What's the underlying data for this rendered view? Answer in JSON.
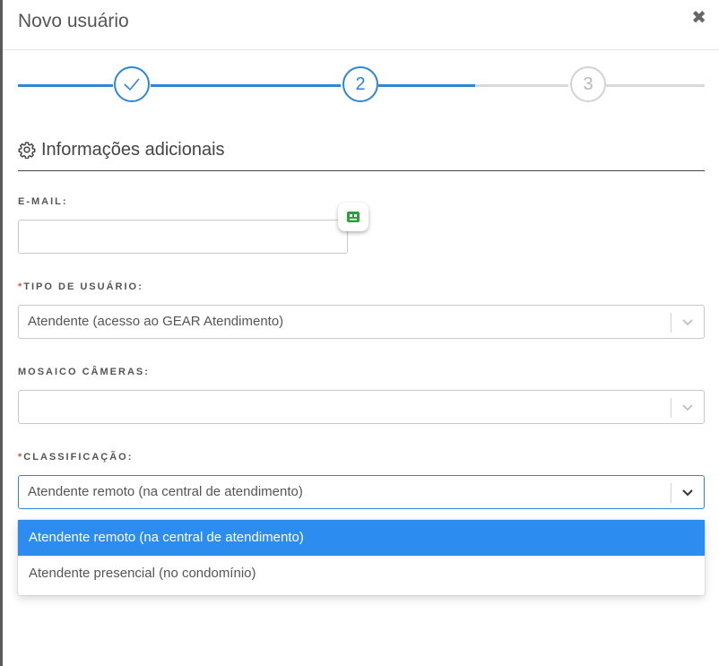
{
  "modal": {
    "title": "Novo usuário",
    "close_symbol": "✖"
  },
  "stepper": {
    "steps": [
      {
        "label": "",
        "state": "done",
        "icon": "check-icon"
      },
      {
        "label": "2",
        "state": "active"
      },
      {
        "label": "3",
        "state": "todo"
      }
    ]
  },
  "section": {
    "title": "Informações adicionais",
    "icon": "gear-icon"
  },
  "fields": {
    "email": {
      "label": "E-MAIL:",
      "value": "",
      "placeholder": ""
    },
    "tipo_usuario": {
      "label": "TIPO DE USUÁRIO:",
      "required": "*",
      "value": "Atendente (acesso ao GEAR Atendimento)"
    },
    "mosaico": {
      "label": "MOSAICO CÂMERAS:",
      "value": ""
    },
    "classificacao": {
      "label": "CLASSIFICAÇÃO:",
      "required": "*",
      "value": "Atendente remoto (na central de atendimento)"
    }
  },
  "dropdown": {
    "options": [
      {
        "label": "Atendente remoto (na central de atendimento)",
        "selected": true
      },
      {
        "label": "Atendente presencial (no condomínio)",
        "selected": false
      }
    ]
  },
  "colors": {
    "accent": "#2f86d6",
    "selected_option": "#2d8cf0",
    "required": "#d9534f",
    "badge_icon": "#2e9e3a"
  }
}
